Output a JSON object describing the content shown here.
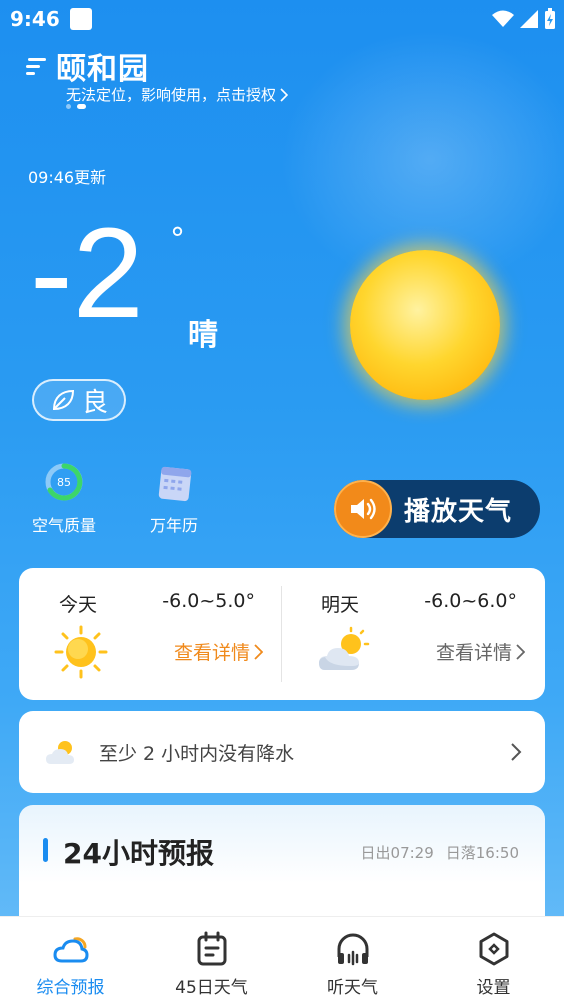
{
  "status_bar": {
    "time": "9:46"
  },
  "header": {
    "city": "颐和园",
    "locate_notice": "无法定位，影响使用，点击授权"
  },
  "current": {
    "update_time": "09:46更新",
    "temperature": "-2",
    "degree_symbol": "°",
    "condition": "晴",
    "air_quality_label": "良"
  },
  "quick_links": [
    {
      "label": "空气质量",
      "icon": "aqi-ring-icon",
      "aqi_value": "85"
    },
    {
      "label": "万年历",
      "icon": "calendar-icon"
    }
  ],
  "play_button": {
    "label": "播放天气"
  },
  "days": [
    {
      "name": "今天",
      "range": "-6.0~5.0°",
      "link": "查看详情",
      "icon": "sun-icon",
      "link_color": "#f08a1c"
    },
    {
      "name": "明天",
      "range": "-6.0~6.0°",
      "link": "查看详情",
      "icon": "partly-cloudy-icon",
      "link_color": "#666666"
    }
  ],
  "rain_notice": {
    "text": "至少 2 小时内没有降水"
  },
  "forecast_24h": {
    "title": "24小时预报",
    "sunrise": "日出07:29",
    "sunset": "日落16:50"
  },
  "tabs": [
    {
      "label": "综合预报",
      "icon": "cloud-sun-icon",
      "active": true
    },
    {
      "label": "45日天气",
      "icon": "calendar-list-icon",
      "active": false
    },
    {
      "label": "听天气",
      "icon": "headphones-icon",
      "active": false
    },
    {
      "label": "设置",
      "icon": "settings-hex-icon",
      "active": false
    }
  ],
  "colors": {
    "accent": "#1a8cf0",
    "orange": "#f08a1c",
    "play_bg": "#0c3d6e"
  }
}
